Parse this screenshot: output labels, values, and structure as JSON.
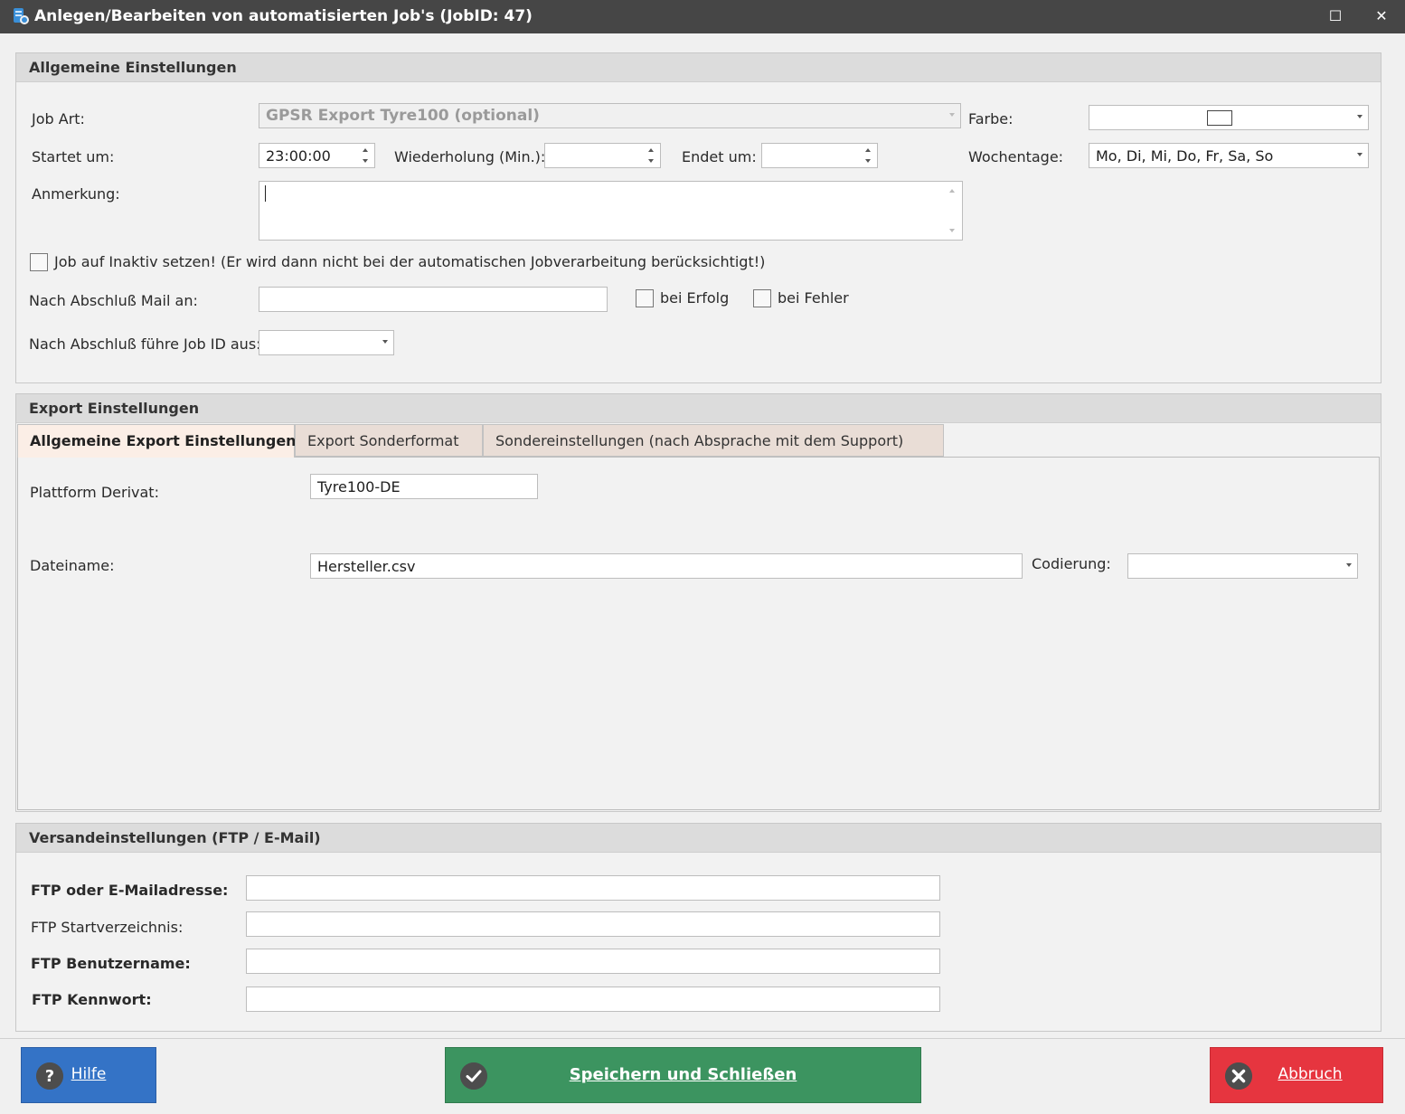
{
  "window": {
    "title": "Anlegen/Bearbeiten von automatisierten Job's (JobID: 47)",
    "maximize_glyph": "☐",
    "close_glyph": "✕"
  },
  "general": {
    "header": "Allgemeine Einstellungen",
    "job_art_label": "Job Art:",
    "job_art_value": "GPSR Export Tyre100 (optional)",
    "farbe_label": "Farbe:",
    "startet_label": "Startet um:",
    "startet_value": "23:00:00",
    "wiederholung_label": "Wiederholung (Min.):",
    "wiederholung_value": "",
    "endet_label": "Endet um:",
    "endet_value": "",
    "wochentage_label": "Wochentage:",
    "wochentage_value": "Mo, Di, Mi, Do, Fr, Sa, So",
    "anmerkung_label": "Anmerkung:",
    "anmerkung_value": "",
    "inaktiv_label": "Job auf Inaktiv setzen! (Er wird dann nicht bei der automatischen Jobverarbeitung berücksichtigt!)",
    "mail_label": "Nach Abschluß Mail an:",
    "mail_value": "",
    "bei_erfolg_label": "bei Erfolg",
    "bei_fehler_label": "bei Fehler",
    "followup_label": "Nach Abschluß führe Job ID aus:",
    "followup_value": ""
  },
  "export": {
    "header": "Export Einstellungen",
    "tabs": [
      {
        "label": "Allgemeine Export Einstellungen"
      },
      {
        "label": "Export Sonderformat"
      },
      {
        "label": "Sondereinstellungen (nach Absprache mit dem Support)"
      }
    ],
    "plattform_label": "Plattform Derivat:",
    "plattform_value": "Tyre100-DE",
    "dateiname_label": "Dateiname:",
    "dateiname_value": "Hersteller.csv",
    "codierung_label": "Codierung:",
    "codierung_value": ""
  },
  "versand": {
    "header": "Versandeinstellungen (FTP / E-Mail)",
    "ftp_address_label": "FTP oder E-Mailadresse:",
    "ftp_address_value": "",
    "ftp_dir_label": "FTP Startverzeichnis:",
    "ftp_dir_value": "",
    "ftp_user_label": "FTP Benutzername:",
    "ftp_user_value": "",
    "ftp_pass_label": "FTP Kennwort:",
    "ftp_pass_value": ""
  },
  "buttons": {
    "help_label": "Hilfe",
    "save_label": "Speichern und Schließen",
    "cancel_label": "Abbruch"
  },
  "icons": {
    "app": "app-database-icon",
    "help": "question-icon",
    "save": "checkmark-icon",
    "cancel": "close-x-icon"
  },
  "colors": {
    "help": "#3473c6",
    "save": "#3c9460",
    "cancel": "#e6353f",
    "active_tab": "#fbeee6",
    "inactive_tab": "#e9ddd6"
  }
}
